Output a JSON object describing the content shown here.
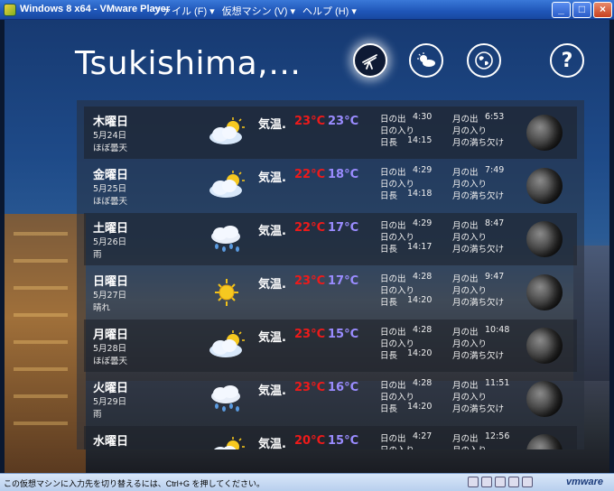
{
  "window": {
    "title": "Windows 8 x64 - VMware Player",
    "menu": [
      "ファイル (F) ▾",
      "仮想マシン (V) ▾",
      "ヘルプ (H) ▾"
    ]
  },
  "app": {
    "city": "Tsukishima,…",
    "nav_icons": [
      "telescope-icon",
      "weather-icon",
      "globe-icon",
      "help-icon"
    ],
    "help_glyph": "?"
  },
  "labels": {
    "temp": "気温.",
    "sunrise": "日の出",
    "sunset": "日の入り",
    "daylength": "日長",
    "moonrise": "月の出",
    "moonset": "月の入り",
    "moonphase": "月の満ち欠け"
  },
  "forecast": [
    {
      "day": "木曜日",
      "date": "5月24日",
      "cond": "ほぼ曇天",
      "icon": "partly-cloudy-icon",
      "hi": "23°C",
      "lo": "23°C",
      "sunrise": "4:30",
      "sunset": "",
      "daylen": "14:15",
      "moonrise": "6:53"
    },
    {
      "day": "金曜日",
      "date": "5月25日",
      "cond": "ほぼ曇天",
      "icon": "partly-cloudy-icon",
      "hi": "22°C",
      "lo": "18°C",
      "sunrise": "4:29",
      "sunset": "",
      "daylen": "14:18",
      "moonrise": "7:49"
    },
    {
      "day": "土曜日",
      "date": "5月26日",
      "cond": "雨",
      "icon": "rain-icon",
      "hi": "22°C",
      "lo": "17°C",
      "sunrise": "4:29",
      "sunset": "",
      "daylen": "14:17",
      "moonrise": "8:47"
    },
    {
      "day": "日曜日",
      "date": "5月27日",
      "cond": "晴れ",
      "icon": "sun-icon",
      "hi": "23°C",
      "lo": "17°C",
      "sunrise": "4:28",
      "sunset": "",
      "daylen": "14:20",
      "moonrise": "9:47"
    },
    {
      "day": "月曜日",
      "date": "5月28日",
      "cond": "ほぼ曇天",
      "icon": "partly-cloudy-icon",
      "hi": "23°C",
      "lo": "15°C",
      "sunrise": "4:28",
      "sunset": "",
      "daylen": "14:20",
      "moonrise": "10:48"
    },
    {
      "day": "火曜日",
      "date": "5月29日",
      "cond": "雨",
      "icon": "rain-icon",
      "hi": "23°C",
      "lo": "16°C",
      "sunrise": "4:28",
      "sunset": "",
      "daylen": "14:20",
      "moonrise": "11:51"
    },
    {
      "day": "水曜日",
      "date": "",
      "cond": "",
      "icon": "partly-cloudy-icon",
      "hi": "20°C",
      "lo": "15°C",
      "sunrise": "4:27",
      "sunset": "",
      "daylen": "",
      "moonrise": "12:56"
    }
  ],
  "statusbar": {
    "text": "この仮想マシンに入力先を切り替えるには、Ctrl+G を押してください。",
    "logo": "vmware"
  },
  "colors": {
    "temp_high": "#ee1a1a",
    "temp_low": "#9a8cff"
  }
}
